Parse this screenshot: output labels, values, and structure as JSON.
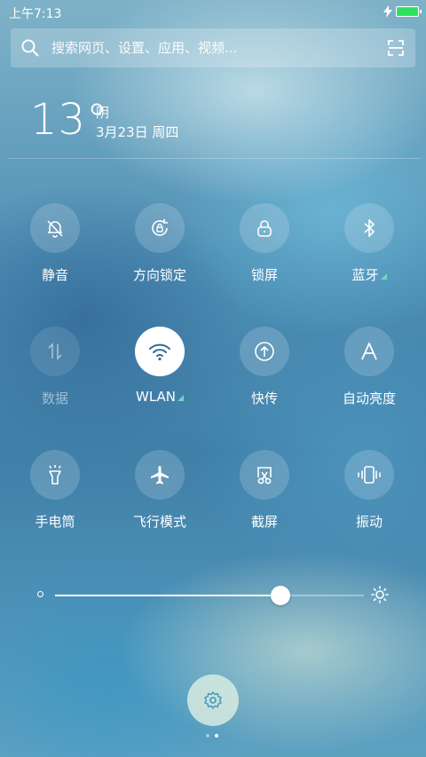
{
  "status": {
    "time": "上午7:13",
    "battery_level": 1.0,
    "charging_icon": "lightning-icon",
    "battery_color": "#2ee05d"
  },
  "search": {
    "placeholder": "搜索网页、设置、应用、视频...",
    "icon": "search-icon",
    "scan_icon": "scan-icon"
  },
  "weather": {
    "temperature": "13°",
    "condition": "阴",
    "date": "3月23日 周四"
  },
  "toggles": [
    {
      "label": "静音",
      "icon": "bell-off-icon",
      "state": "off"
    },
    {
      "label": "方向锁定",
      "icon": "rotation-lock-icon",
      "state": "off"
    },
    {
      "label": "锁屏",
      "icon": "lock-icon",
      "state": "off"
    },
    {
      "label": "蓝牙",
      "icon": "bluetooth-icon",
      "state": "off",
      "has_more": true
    },
    {
      "label": "数据",
      "icon": "mobile-data-icon",
      "state": "disabled"
    },
    {
      "label": "WLAN",
      "icon": "wifi-icon",
      "state": "on",
      "has_more": true
    },
    {
      "label": "快传",
      "icon": "quick-share-icon",
      "state": "off"
    },
    {
      "label": "自动亮度",
      "icon": "auto-brightness-icon",
      "state": "off"
    },
    {
      "label": "手电筒",
      "icon": "flashlight-icon",
      "state": "off"
    },
    {
      "label": "飞行模式",
      "icon": "airplane-icon",
      "state": "off"
    },
    {
      "label": "截屏",
      "icon": "screenshot-icon",
      "state": "off"
    },
    {
      "label": "振动",
      "icon": "vibrate-icon",
      "state": "off"
    }
  ],
  "brightness": {
    "level_fraction": 0.73
  },
  "colors": {
    "accent_corner": "#6fd6c6",
    "active_icon": "#2f6f8f"
  },
  "pager": {
    "pages": 2,
    "active_page": 2
  }
}
